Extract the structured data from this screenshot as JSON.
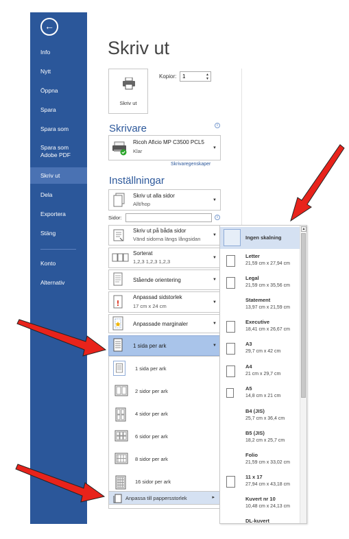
{
  "sidebar": {
    "back_glyph": "←",
    "items": [
      {
        "label": "Info"
      },
      {
        "label": "Nytt"
      },
      {
        "label": "Öppna"
      },
      {
        "label": "Spara"
      },
      {
        "label": "Spara som"
      },
      {
        "label": "Spara som Adobe PDF"
      },
      {
        "label": "Skriv ut",
        "active": true
      },
      {
        "label": "Dela"
      },
      {
        "label": "Exportera"
      },
      {
        "label": "Stäng"
      },
      {
        "label": "Konto"
      },
      {
        "label": "Alternativ"
      }
    ],
    "accent": "#2b579a"
  },
  "page_title": "Skriv ut",
  "print": {
    "button_label": "Skriv ut",
    "copies_label": "Kopior:",
    "copies_value": "1"
  },
  "printer": {
    "heading": "Skrivare",
    "name": "Ricoh Aficio MP C3500 PCL5",
    "status": "Klar",
    "properties_link": "Skrivaregenskaper"
  },
  "settings": {
    "heading": "Inställningar",
    "print_range": {
      "line1": "Skriv ut alla sidor",
      "line2": "Allt/hop"
    },
    "pages_label": "Sidor:",
    "duplex": {
      "line1": "Skriv ut på båda sidor",
      "line2": "Vänd sidorna längs långsidan"
    },
    "collate": {
      "line1": "Sorterat",
      "line2": "1,2,3   1,2,3   1,2,3"
    },
    "orientation": "Stående orientering",
    "paper_size": {
      "line1": "Anpassad sidstorlek",
      "line2": "17 cm x 24 cm"
    },
    "margins": "Anpassade marginaler",
    "pages_per_sheet": "1 sida per ark"
  },
  "pps_options": [
    {
      "label": "1 sida per ark"
    },
    {
      "label": "2 sidor per ark"
    },
    {
      "label": "4 sidor per ark"
    },
    {
      "label": "6 sidor per ark"
    },
    {
      "label": "8 sidor per ark"
    },
    {
      "label": "16 sidor per ark"
    }
  ],
  "fit_to_paper": "Anpassa till pappersstorlek",
  "paper_sizes": [
    {
      "name": "Ingen skalning",
      "dims": ""
    },
    {
      "name": "Letter",
      "dims": "21,59 cm x 27,94 cm"
    },
    {
      "name": "Legal",
      "dims": "21,59 cm x 35,56 cm"
    },
    {
      "name": "Statement",
      "dims": "13,97 cm x 21,59 cm"
    },
    {
      "name": "Executive",
      "dims": "18,41 cm x 26,67 cm"
    },
    {
      "name": "A3",
      "dims": "29,7 cm x 42 cm"
    },
    {
      "name": "A4",
      "dims": "21 cm x 29,7 cm"
    },
    {
      "name": "A5",
      "dims": "14,8 cm x 21 cm"
    },
    {
      "name": "B4 (JIS)",
      "dims": "25,7 cm x 36,4 cm"
    },
    {
      "name": "B5 (JIS)",
      "dims": "18,2 cm x 25,7 cm"
    },
    {
      "name": "Folio",
      "dims": "21,59 cm x 33,02 cm"
    },
    {
      "name": "11 x 17",
      "dims": "27,94 cm x 43,18 cm"
    },
    {
      "name": "Kuvert nr 10",
      "dims": "10,48 cm x 24,13 cm"
    },
    {
      "name": "DL-kuvert",
      "dims": ""
    }
  ],
  "colors": {
    "arrow": "#e8231b",
    "selection": "#a9c4ea"
  }
}
